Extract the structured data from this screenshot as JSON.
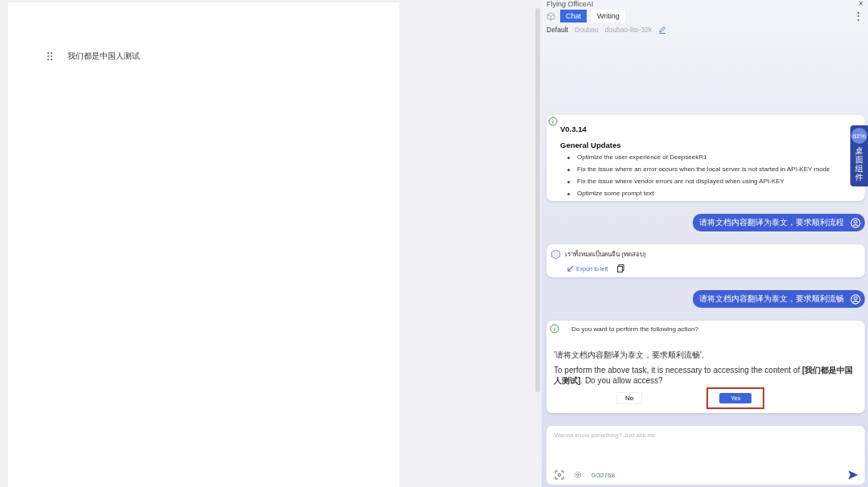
{
  "document": {
    "paragraph": "我们都是中国人测试"
  },
  "panel": {
    "title": "Flying OfficeAI",
    "close_glyph": "×",
    "more_glyph": "⋮",
    "tabs": [
      {
        "label": "Chat",
        "selected": true
      },
      {
        "label": "Writing",
        "selected": false
      }
    ],
    "model": {
      "preset": "Default",
      "provider": "Doubao",
      "name": "doubao-lite-32k"
    },
    "widget": {
      "percent": "62%",
      "label": "桌面组件"
    },
    "messages": [
      {
        "kind": "notice",
        "version": "V0.3.14",
        "heading": "General Updates",
        "items": [
          "Optimize the user experience of DeepseekR1",
          "Fix the issue where an error occurs when the local server is not started in API-KEY mode",
          "Fix the issue where vendor errors are not displayed when using API-KEY",
          "Optimize some prompt text"
        ]
      },
      {
        "kind": "user",
        "text": "请将文档内容翻译为泰文，要求顺利流程"
      },
      {
        "kind": "assistant",
        "text": "เราทั้งหมดเป็นคนจีน (ทดสอบ)",
        "action": "Export to left"
      },
      {
        "kind": "user",
        "text": "请将文档内容翻译为泰文，要求顺利流畅"
      },
      {
        "kind": "confirm",
        "question": "Do you want to perform the following action?",
        "quote": "'请将文档内容翻译为泰文，要求顺利流畅',",
        "body": "To perform the above task, it is necessary to accessing the content of **[我们都是中国人测试]**. Do you allow access?",
        "no": "No",
        "yes": "Yes",
        "yes_highlighted": true
      }
    ],
    "input": {
      "placeholder": "Wanna know something? Just ask me",
      "counter": "0/32768"
    }
  }
}
